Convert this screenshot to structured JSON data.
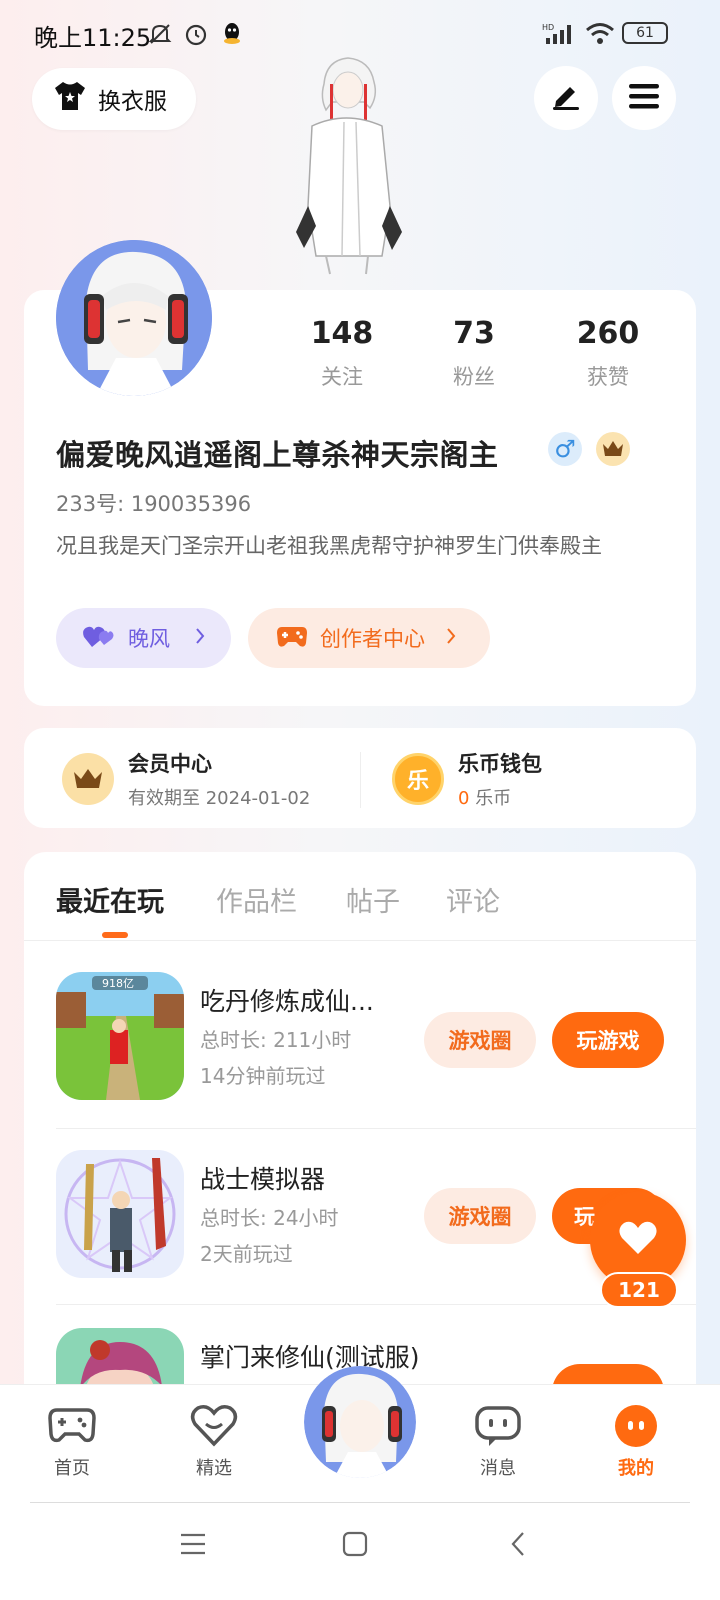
{
  "status_bar": {
    "time": "晚上11:25",
    "battery": "61"
  },
  "top": {
    "dress_label": "换衣服"
  },
  "profile": {
    "stats": [
      {
        "value": "148",
        "label": "关注"
      },
      {
        "value": "73",
        "label": "粉丝"
      },
      {
        "value": "260",
        "label": "获赞"
      }
    ],
    "nickname": "偏爱晚风逍遥阁上尊杀神天宗阁主",
    "gender_symbol": "♂",
    "uid": "233号: 190035396",
    "bio": "况且我是天门圣宗开山老祖我黑虎帮守护神罗生门供奉殿主",
    "fan_chip": "晚风",
    "creator_chip": "创作者中心"
  },
  "membership": {
    "vip_title": "会员中心",
    "vip_sub": "有效期至 2024-01-02",
    "wallet_title": "乐币钱包",
    "wallet_icon_char": "乐",
    "wallet_amount": "0",
    "wallet_unit": "乐币"
  },
  "tabs": [
    "最近在玩",
    "作品栏",
    "帖子",
    "评论"
  ],
  "games": [
    {
      "name": "吃丹修炼成仙...",
      "duration": "总时长: 211小时",
      "last_played": "14分钟前玩过",
      "circle_label": "游戏圈",
      "play_label": "玩游戏",
      "thumb_text": "918亿"
    },
    {
      "name": "战士模拟器",
      "duration": "总时长: 24小时",
      "last_played": "2天前玩过",
      "circle_label": "游戏圈",
      "play_label": "玩"
    },
    {
      "name": "掌门来修仙(测试服)"
    }
  ],
  "float_like": {
    "count": "121"
  },
  "nav": [
    {
      "label": "首页",
      "icon": "gamepad-icon"
    },
    {
      "label": "精选",
      "icon": "heart-outline-icon"
    },
    {
      "label": "",
      "icon": "avatar"
    },
    {
      "label": "消息",
      "icon": "chat-bubble-icon"
    },
    {
      "label": "我的",
      "icon": "smile-icon"
    }
  ],
  "colors": {
    "accent": "#ff6a10",
    "purple": "#6f5ee0",
    "gold": "#f5b430"
  }
}
